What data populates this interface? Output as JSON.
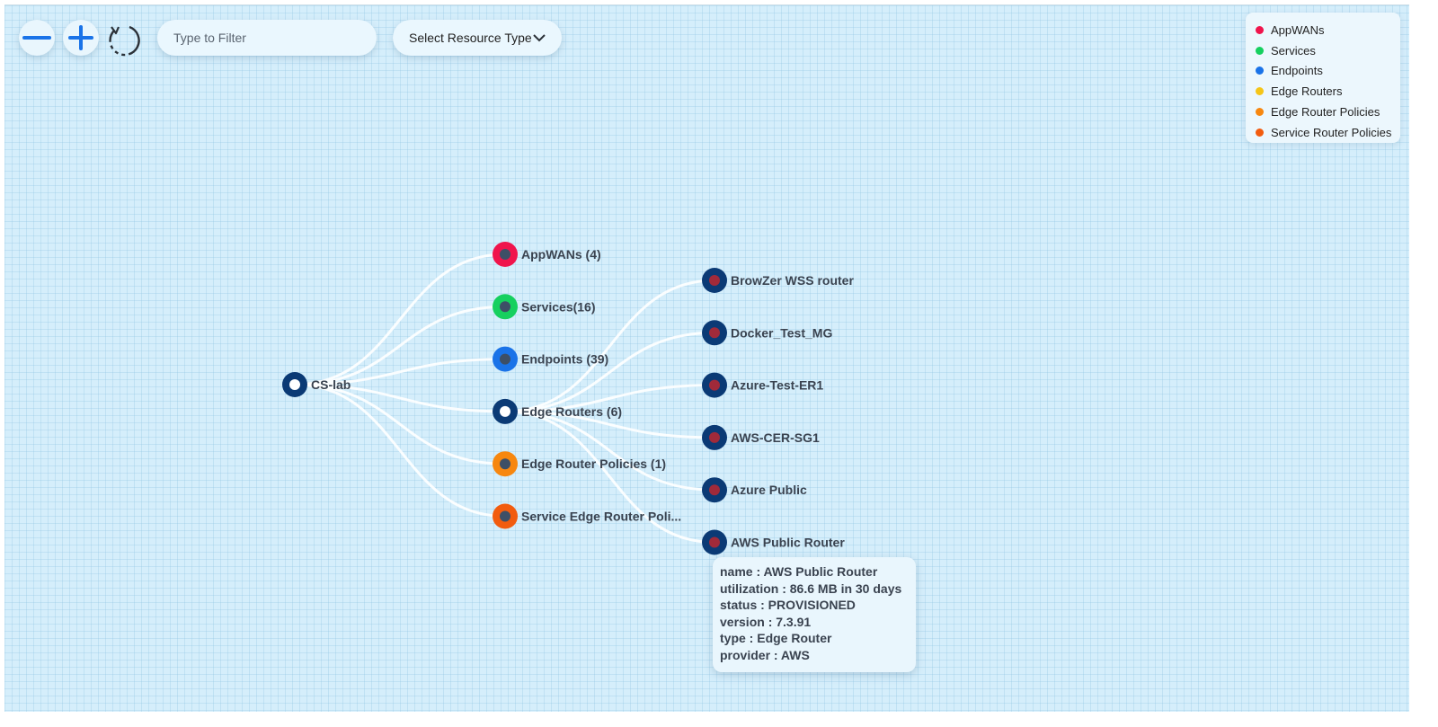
{
  "toolbar": {
    "zoom_out_icon": "minus-icon",
    "zoom_in_icon": "plus-icon",
    "refresh_icon": "refresh-icon",
    "filter_placeholder": "Type to Filter",
    "filter_value": "",
    "resource_select_label": "Select Resource Type"
  },
  "legend": {
    "items": [
      {
        "label": "AppWANs",
        "color": "#f0144c"
      },
      {
        "label": "Services",
        "color": "#16d05f"
      },
      {
        "label": "Endpoints",
        "color": "#1a73e8"
      },
      {
        "label": "Edge Routers",
        "color": "#f5c518"
      },
      {
        "label": "Edge Router Policies",
        "color": "#f7870f"
      },
      {
        "label": "Service Router Policies",
        "color": "#f25c0f"
      }
    ]
  },
  "graph": {
    "root": {
      "label": "CS-lab",
      "color": "#0b3a75"
    },
    "categories": [
      {
        "label": "AppWANs (4)",
        "color": "#f0144c"
      },
      {
        "label": "Services(16)",
        "color": "#16d05f"
      },
      {
        "label": "Endpoints (39)",
        "color": "#1a73e8"
      },
      {
        "label": "Edge Routers (6)",
        "color": "#0b3a75"
      },
      {
        "label": "Edge Router Policies (1)",
        "color": "#f7870f"
      },
      {
        "label": "Service Edge Router Poli...",
        "color": "#f25c0f"
      }
    ],
    "routers": [
      {
        "label": "BrowZer WSS router"
      },
      {
        "label": "Docker_Test_MG"
      },
      {
        "label": "Azure-Test-ER1"
      },
      {
        "label": "AWS-CER-SG1"
      },
      {
        "label": "Azure Public"
      },
      {
        "label": "AWS Public Router"
      }
    ],
    "colors": {
      "link": "#ffffff",
      "router_ring": "#0b3a75",
      "router_core": "#a12a3a",
      "category_core": "#3d4f66"
    }
  },
  "tooltip": {
    "lines": [
      "name : AWS Public Router",
      "utilization : 86.6 MB in 30 days",
      "status : PROVISIONED",
      "version : 7.3.91",
      "type : Edge Router",
      "provider : AWS"
    ]
  }
}
